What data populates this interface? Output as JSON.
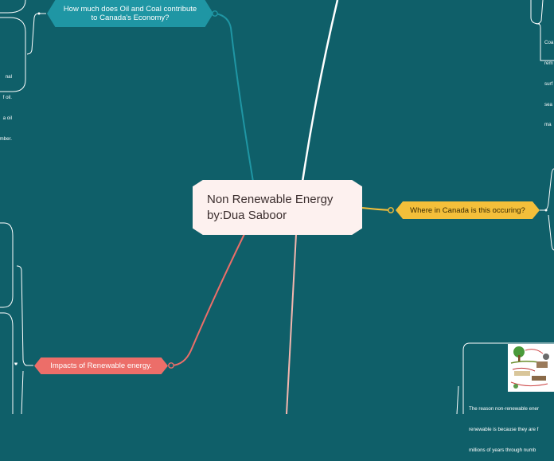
{
  "central": {
    "label": "Non Renewable Energy by:Dua Saboor"
  },
  "topics": {
    "oil_coal": {
      "label": "How much does Oil and Coal contribute to Canada's Economy?",
      "color": "#1f96a4"
    },
    "where": {
      "label": "Where in Canada is this occuring?",
      "color": "#f4bf3a"
    },
    "impacts": {
      "label": "Impacts of Renewable energy.",
      "color": "#ec6e69"
    }
  },
  "notes": {
    "left_partial": [
      "nal",
      "f oil.",
      "a oil",
      "mber."
    ],
    "right_top_partial": [
      "Coa",
      "rem",
      "surf",
      "sea",
      "ma"
    ],
    "bottom_right_partial": [
      "The reason non-renewable ener",
      "renewable is because they are f",
      "millions of years through numb"
    ]
  },
  "colors": {
    "background": "#0f5f69",
    "line_white": "#ffffff",
    "line_teal": "#1f96a4",
    "line_yellow": "#f4bf3a",
    "line_salmon": "#ec6e69",
    "line_pink": "#f3b6ae"
  }
}
